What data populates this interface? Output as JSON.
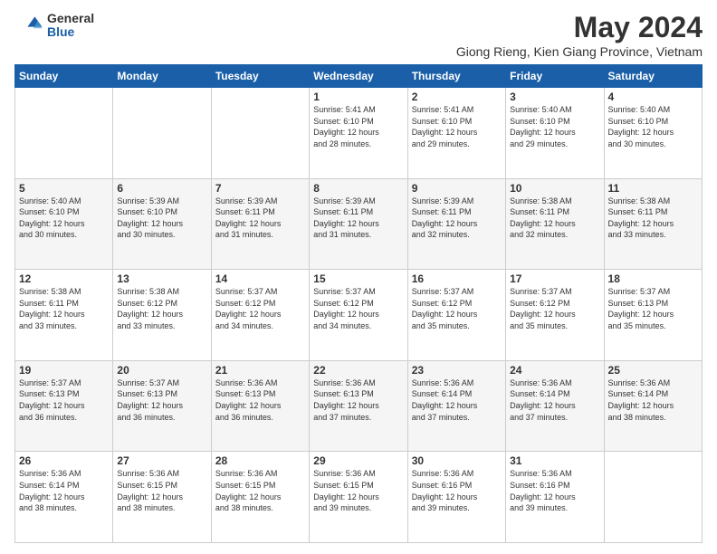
{
  "logo": {
    "general": "General",
    "blue": "Blue"
  },
  "title": "May 2024",
  "subtitle": "Giong Rieng, Kien Giang Province, Vietnam",
  "days": [
    "Sunday",
    "Monday",
    "Tuesday",
    "Wednesday",
    "Thursday",
    "Friday",
    "Saturday"
  ],
  "weeks": [
    [
      {
        "day": "",
        "content": ""
      },
      {
        "day": "",
        "content": ""
      },
      {
        "day": "",
        "content": ""
      },
      {
        "day": "1",
        "content": "Sunrise: 5:41 AM\nSunset: 6:10 PM\nDaylight: 12 hours\nand 28 minutes."
      },
      {
        "day": "2",
        "content": "Sunrise: 5:41 AM\nSunset: 6:10 PM\nDaylight: 12 hours\nand 29 minutes."
      },
      {
        "day": "3",
        "content": "Sunrise: 5:40 AM\nSunset: 6:10 PM\nDaylight: 12 hours\nand 29 minutes."
      },
      {
        "day": "4",
        "content": "Sunrise: 5:40 AM\nSunset: 6:10 PM\nDaylight: 12 hours\nand 30 minutes."
      }
    ],
    [
      {
        "day": "5",
        "content": "Sunrise: 5:40 AM\nSunset: 6:10 PM\nDaylight: 12 hours\nand 30 minutes."
      },
      {
        "day": "6",
        "content": "Sunrise: 5:39 AM\nSunset: 6:10 PM\nDaylight: 12 hours\nand 30 minutes."
      },
      {
        "day": "7",
        "content": "Sunrise: 5:39 AM\nSunset: 6:11 PM\nDaylight: 12 hours\nand 31 minutes."
      },
      {
        "day": "8",
        "content": "Sunrise: 5:39 AM\nSunset: 6:11 PM\nDaylight: 12 hours\nand 31 minutes."
      },
      {
        "day": "9",
        "content": "Sunrise: 5:39 AM\nSunset: 6:11 PM\nDaylight: 12 hours\nand 32 minutes."
      },
      {
        "day": "10",
        "content": "Sunrise: 5:38 AM\nSunset: 6:11 PM\nDaylight: 12 hours\nand 32 minutes."
      },
      {
        "day": "11",
        "content": "Sunrise: 5:38 AM\nSunset: 6:11 PM\nDaylight: 12 hours\nand 33 minutes."
      }
    ],
    [
      {
        "day": "12",
        "content": "Sunrise: 5:38 AM\nSunset: 6:11 PM\nDaylight: 12 hours\nand 33 minutes."
      },
      {
        "day": "13",
        "content": "Sunrise: 5:38 AM\nSunset: 6:12 PM\nDaylight: 12 hours\nand 33 minutes."
      },
      {
        "day": "14",
        "content": "Sunrise: 5:37 AM\nSunset: 6:12 PM\nDaylight: 12 hours\nand 34 minutes."
      },
      {
        "day": "15",
        "content": "Sunrise: 5:37 AM\nSunset: 6:12 PM\nDaylight: 12 hours\nand 34 minutes."
      },
      {
        "day": "16",
        "content": "Sunrise: 5:37 AM\nSunset: 6:12 PM\nDaylight: 12 hours\nand 35 minutes."
      },
      {
        "day": "17",
        "content": "Sunrise: 5:37 AM\nSunset: 6:12 PM\nDaylight: 12 hours\nand 35 minutes."
      },
      {
        "day": "18",
        "content": "Sunrise: 5:37 AM\nSunset: 6:13 PM\nDaylight: 12 hours\nand 35 minutes."
      }
    ],
    [
      {
        "day": "19",
        "content": "Sunrise: 5:37 AM\nSunset: 6:13 PM\nDaylight: 12 hours\nand 36 minutes."
      },
      {
        "day": "20",
        "content": "Sunrise: 5:37 AM\nSunset: 6:13 PM\nDaylight: 12 hours\nand 36 minutes."
      },
      {
        "day": "21",
        "content": "Sunrise: 5:36 AM\nSunset: 6:13 PM\nDaylight: 12 hours\nand 36 minutes."
      },
      {
        "day": "22",
        "content": "Sunrise: 5:36 AM\nSunset: 6:13 PM\nDaylight: 12 hours\nand 37 minutes."
      },
      {
        "day": "23",
        "content": "Sunrise: 5:36 AM\nSunset: 6:14 PM\nDaylight: 12 hours\nand 37 minutes."
      },
      {
        "day": "24",
        "content": "Sunrise: 5:36 AM\nSunset: 6:14 PM\nDaylight: 12 hours\nand 37 minutes."
      },
      {
        "day": "25",
        "content": "Sunrise: 5:36 AM\nSunset: 6:14 PM\nDaylight: 12 hours\nand 38 minutes."
      }
    ],
    [
      {
        "day": "26",
        "content": "Sunrise: 5:36 AM\nSunset: 6:14 PM\nDaylight: 12 hours\nand 38 minutes."
      },
      {
        "day": "27",
        "content": "Sunrise: 5:36 AM\nSunset: 6:15 PM\nDaylight: 12 hours\nand 38 minutes."
      },
      {
        "day": "28",
        "content": "Sunrise: 5:36 AM\nSunset: 6:15 PM\nDaylight: 12 hours\nand 38 minutes."
      },
      {
        "day": "29",
        "content": "Sunrise: 5:36 AM\nSunset: 6:15 PM\nDaylight: 12 hours\nand 39 minutes."
      },
      {
        "day": "30",
        "content": "Sunrise: 5:36 AM\nSunset: 6:16 PM\nDaylight: 12 hours\nand 39 minutes."
      },
      {
        "day": "31",
        "content": "Sunrise: 5:36 AM\nSunset: 6:16 PM\nDaylight: 12 hours\nand 39 minutes."
      },
      {
        "day": "",
        "content": ""
      }
    ]
  ]
}
